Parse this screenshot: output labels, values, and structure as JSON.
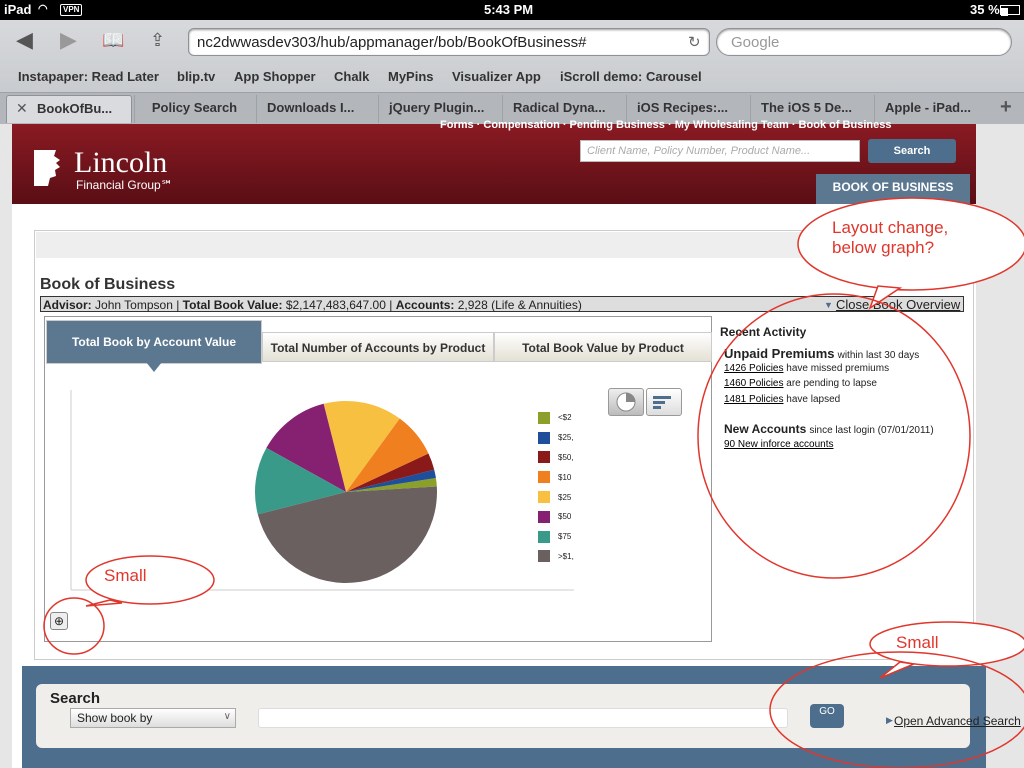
{
  "status": {
    "device": "iPad",
    "vpn": "VPN",
    "time": "5:43 PM",
    "battery": "35 %"
  },
  "browser": {
    "url": "nc2dwwasdev303/hub/appmanager/bob/BookOfBusiness#",
    "search_placeholder": "Google",
    "bookmarks": [
      "Instapaper: Read Later",
      "blip.tv",
      "App Shopper",
      "Chalk",
      "MyPins",
      "Visualizer App",
      "iScroll demo: Carousel"
    ],
    "tabs": [
      "BookOfBu...",
      "Policy Search",
      "Downloads I...",
      "jQuery Plugin...",
      "Radical Dyna...",
      "iOS Recipes:...",
      "The iOS 5 De...",
      "Apple - iPad..."
    ]
  },
  "header": {
    "top_nav": "Forms · Compensation · Pending Business · My Wholesaling Team · Book of Business",
    "logo_name": "Lincoln",
    "logo_sub": "Financial Group℠",
    "search_placeholder": "Client Name, Policy Number, Product Name...",
    "search_button": "Search",
    "active_tab": "BOOK OF BUSINESS"
  },
  "book": {
    "title": "Book of Business",
    "advisor_label": "Advisor:",
    "advisor": "John Tompson",
    "total_label": "Total Book Value:",
    "total": "$2,147,483,647.00",
    "accounts_label": "Accounts:",
    "accounts": "2,928 (Life & Annuities)",
    "close": "Close Book Overview"
  },
  "chart_tabs": [
    "Total Book by Account Value",
    "Total Number of Accounts by Product",
    "Total Book Value by Product"
  ],
  "chart_data": {
    "type": "pie",
    "categories": [
      "<$2",
      "$25,",
      "$50,",
      "$10",
      "$25",
      "$50",
      "$75",
      ">$1,"
    ],
    "values": [
      1.5,
      1.5,
      3,
      8,
      14,
      13,
      12,
      47
    ],
    "colors": [
      "#8aa02a",
      "#1f4e9a",
      "#8a1a1a",
      "#f07f20",
      "#f8c040",
      "#862070",
      "#3a9a8a",
      "#6a6060"
    ]
  },
  "recent": {
    "title": "Recent Activity",
    "unpaid_title": "Unpaid Premiums",
    "unpaid_sub": "within last 30 days",
    "items": [
      {
        "link": "1426 Policies",
        "text": "have missed premiums"
      },
      {
        "link": "1460 Policies",
        "text": "are pending to lapse"
      },
      {
        "link": "1481 Policies",
        "text": "have lapsed"
      }
    ],
    "new_title": "New Accounts",
    "new_sub": "since last login (07/01/2011)",
    "new_link": "90 New inforce accounts"
  },
  "search": {
    "title": "Search",
    "select": "Show book by",
    "go": "GO",
    "advanced": "Open Advanced Search"
  },
  "callouts": {
    "layout": "Layout change, below graph?",
    "small1": "Small",
    "small2": "Small"
  }
}
